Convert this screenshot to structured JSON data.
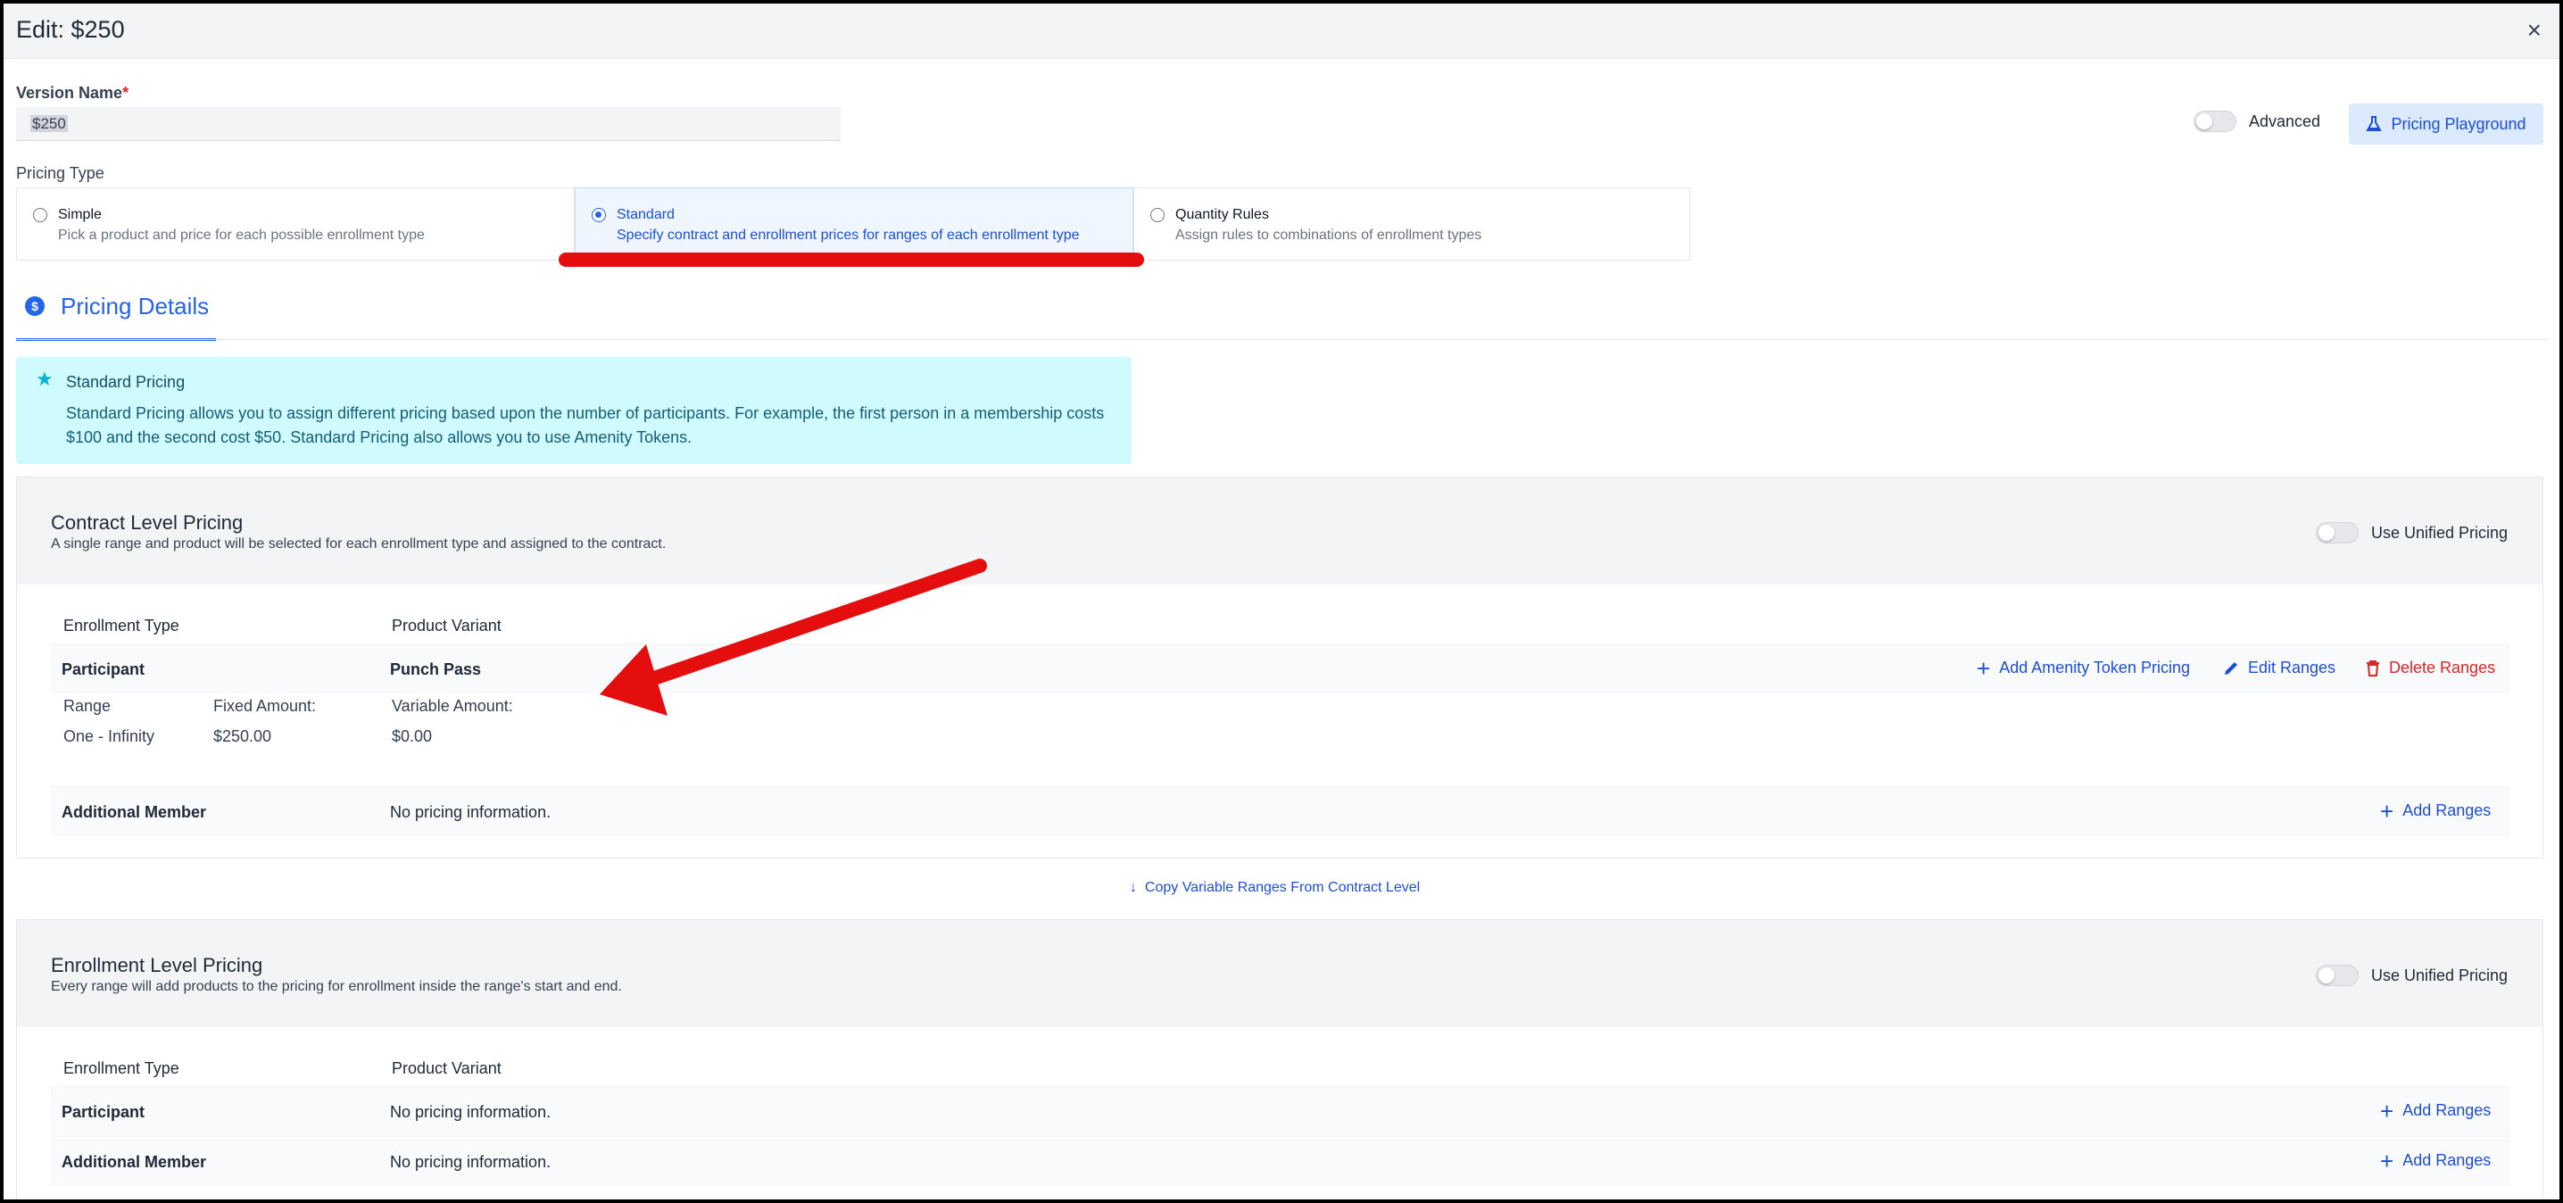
{
  "window": {
    "title": "Edit: $250",
    "close_glyph": "×"
  },
  "version": {
    "label": "Version Name",
    "required_mark": "*",
    "value": "$250"
  },
  "advanced": {
    "label": "Advanced"
  },
  "playground": {
    "label": "Pricing Playground",
    "icon": "beaker-icon"
  },
  "pricing_type": {
    "label": "Pricing Type",
    "options": [
      {
        "title": "Simple",
        "desc": "Pick a product and price for each possible enrollment type",
        "selected": false
      },
      {
        "title": "Standard",
        "desc": "Specify contract and enrollment prices for ranges of each enrollment type",
        "selected": true
      },
      {
        "title": "Quantity Rules",
        "desc": "Assign rules to combinations of enrollment types",
        "selected": false
      }
    ]
  },
  "section": {
    "title": "Pricing Details",
    "icon_glyph": "$"
  },
  "info": {
    "title": "Standard Pricing",
    "body": "Standard Pricing allows you to assign different pricing based upon the number of participants. For example, the first person in a membership costs $100 and the second cost $50. Standard Pricing also allows you to use Amenity Tokens."
  },
  "contract": {
    "title": "Contract Level Pricing",
    "desc": "A single range and product will be selected for each enrollment type and assigned to the contract.",
    "unified_label": "Use Unified Pricing",
    "col_type": "Enrollment Type",
    "col_variant": "Product Variant",
    "participant": {
      "type": "Participant",
      "variant": "Punch Pass",
      "add_token": "Add Amenity Token Pricing",
      "edit_ranges": "Edit Ranges",
      "delete_ranges": "Delete Ranges",
      "range_head": "Range",
      "fixed_head": "Fixed Amount:",
      "variable_head": "Variable Amount:",
      "range": "One - Infinity",
      "fixed": "$250.00",
      "variable": "$0.00"
    },
    "additional": {
      "type": "Additional Member",
      "variant": "No pricing information.",
      "add_ranges": "Add Ranges"
    }
  },
  "copy_link": "Copy Variable Ranges From Contract Level",
  "enrollment": {
    "title": "Enrollment Level Pricing",
    "desc": "Every range will add products to the pricing for enrollment inside the range's start and end.",
    "unified_label": "Use Unified Pricing",
    "col_type": "Enrollment Type",
    "col_variant": "Product Variant",
    "rows": [
      {
        "type": "Participant",
        "variant": "No pricing information.",
        "add_ranges": "Add Ranges"
      },
      {
        "type": "Additional Member",
        "variant": "No pricing information.",
        "add_ranges": "Add Ranges"
      }
    ]
  },
  "colors": {
    "accent": "#2563eb",
    "danger": "#dc2626",
    "annotation": "#e40e0e",
    "info_bg": "#cffafe"
  }
}
